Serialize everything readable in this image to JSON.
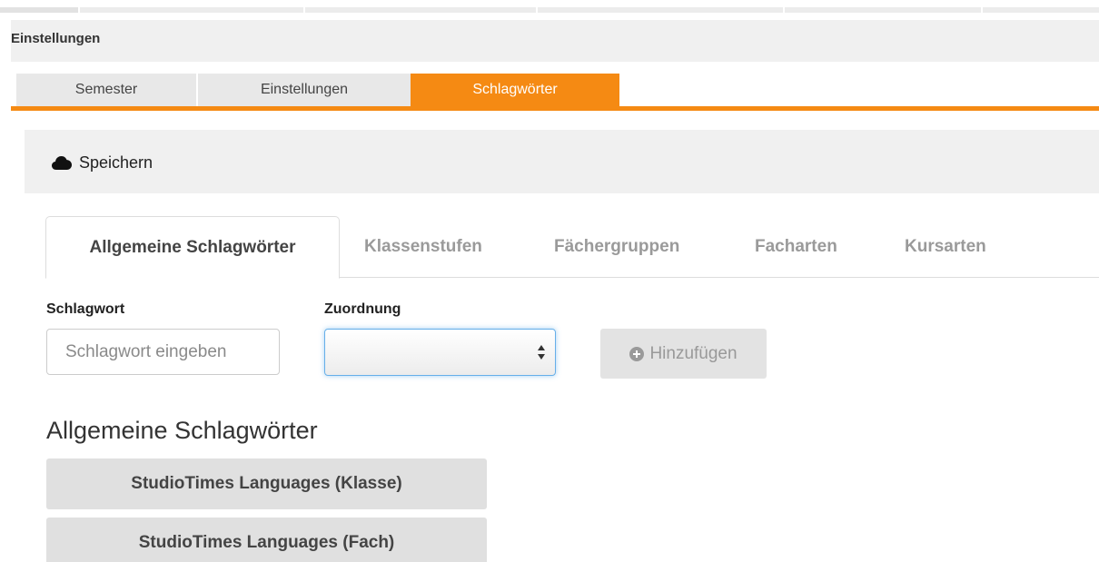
{
  "panel": {
    "title": "Einstellungen"
  },
  "main_tabs": [
    {
      "label": "Semester",
      "active": false
    },
    {
      "label": "Einstellungen",
      "active": false
    },
    {
      "label": "Schlagwörter",
      "active": true
    }
  ],
  "toolbar": {
    "save_label": "Speichern",
    "save_icon": "cloud-icon"
  },
  "sub_tabs": [
    {
      "label": "Allgemeine Schlagwörter",
      "active": true
    },
    {
      "label": "Klassenstufen",
      "active": false
    },
    {
      "label": "Fächergruppen",
      "active": false
    },
    {
      "label": "Facharten",
      "active": false
    },
    {
      "label": "Kursarten",
      "active": false
    }
  ],
  "form": {
    "keyword_label": "Schlagwort",
    "keyword_placeholder": "Schlagwort eingeben",
    "keyword_value": "",
    "assignment_label": "Zuordnung",
    "assignment_value": "",
    "add_label": "Hinzufügen",
    "add_icon": "plus-circle-icon"
  },
  "section": {
    "title": "Allgemeine Schlagwörter",
    "keywords": [
      "StudioTimes Languages (Klasse)",
      "StudioTimes Languages (Fach)"
    ]
  },
  "colors": {
    "accent": "#f58a13",
    "focus": "#66afe9"
  }
}
